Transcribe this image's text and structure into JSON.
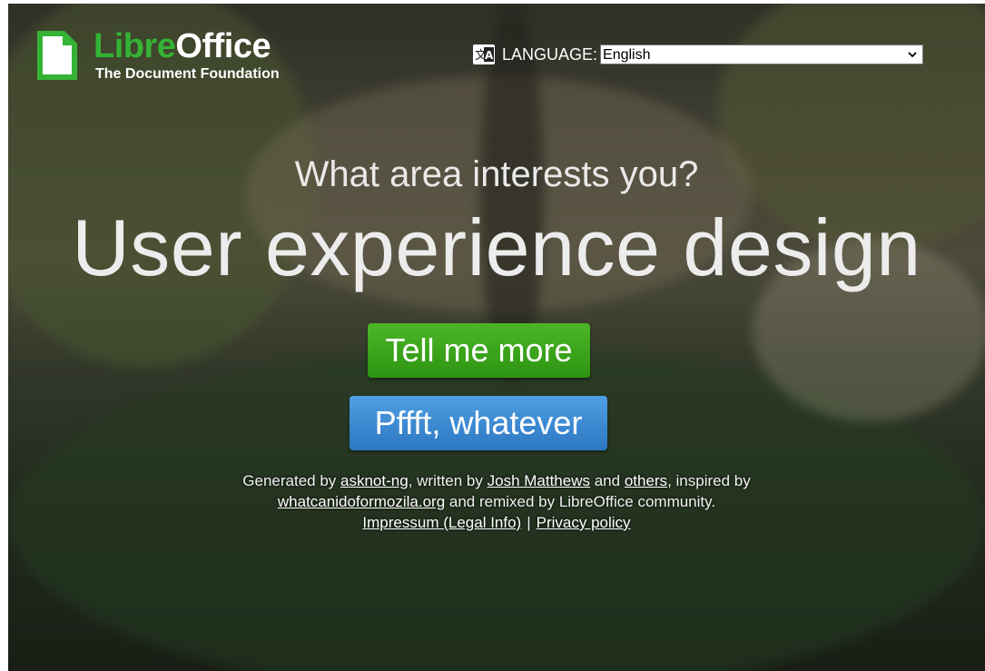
{
  "logo": {
    "libre": "Libre",
    "office": "Office",
    "subtitle": "The Document Foundation",
    "brand_color": "#34b335"
  },
  "language": {
    "label": "LANGUAGE:",
    "selected": "English",
    "icon": "translate-icon"
  },
  "main": {
    "question": "What area interests you?",
    "area": "User experience design"
  },
  "buttons": {
    "more": "Tell me more",
    "dismiss": "Pffft, whatever",
    "more_color": "#3aa51b",
    "dismiss_color": "#3a89d3"
  },
  "footer": {
    "generated_by": "Generated by ",
    "asknot": "asknot-ng",
    "written_by": ", written by ",
    "author": "Josh Matthews",
    "and": " and ",
    "others": "others",
    "inspired": ", inspired by",
    "whatcanido": "whatcanidoformozila.org",
    "remixed": " and remixed by LibreOffice community.",
    "impressum": "Impressum (Legal Info)",
    "separator": "|",
    "privacy": "Privacy policy"
  }
}
